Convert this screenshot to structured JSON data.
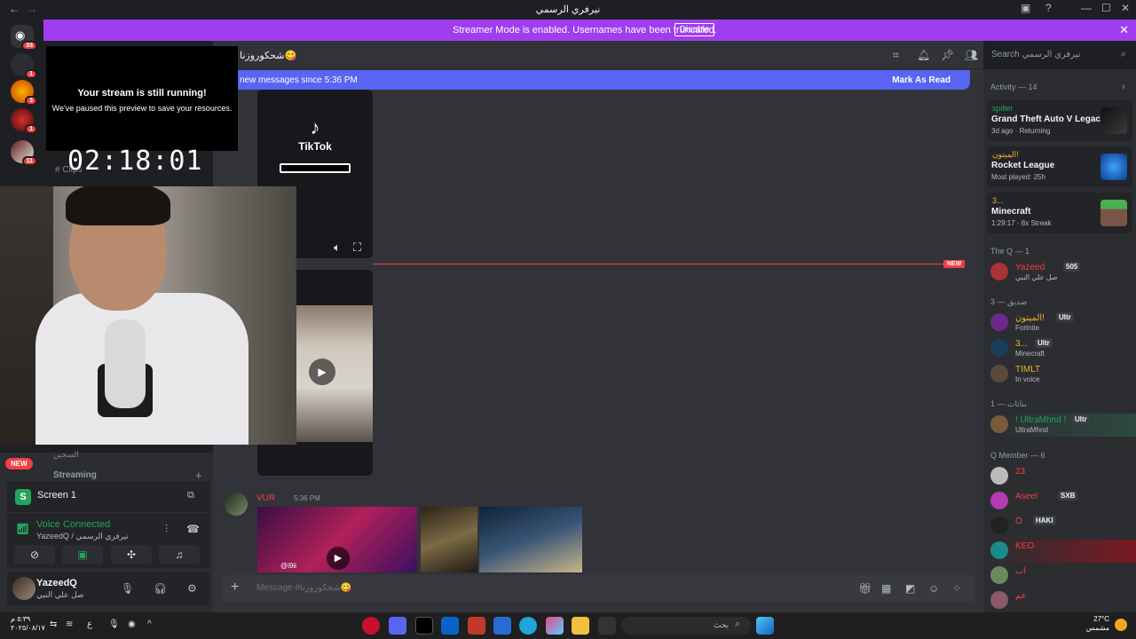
{
  "titlebar": {
    "title": "نيرفري الرسمي",
    "back": "←",
    "forward": "→"
  },
  "banner": {
    "message": "Streamer Mode is enabled. Usernames have been truncated.",
    "disable": "Disable",
    "close": "✕"
  },
  "guilds": {
    "home_badge": "33",
    "badges": [
      "1",
      "3",
      "1",
      "11"
    ]
  },
  "header": {
    "channel": "شحكوروزنا😋"
  },
  "search": {
    "placeholder": "Search نيرفري الرسمي"
  },
  "new_messages": {
    "text": "new messages since 5:36 PM",
    "mark": "Mark As Read"
  },
  "stream_overlay": {
    "title": "Your stream is still running!",
    "subtitle": "We've paused this preview to save your resources.",
    "timer": "02:18:01"
  },
  "channels": {
    "clips": "Clips",
    "lounge": "السجين",
    "new_badge": "NEW",
    "streaming": "Streaming"
  },
  "tiktok": {
    "label": "TikTok"
  },
  "new_tag": "NEW",
  "message2": {
    "author": "VUR",
    "time": "5:36 PM",
    "media_tag": "@i9ii"
  },
  "composer": {
    "placeholder": "Message #شحكوروزنا😋"
  },
  "screen_share": {
    "label": "Screen 1"
  },
  "voice": {
    "status": "Voice Connected",
    "sub": "YazeedQ / نيرفري الرسمي"
  },
  "user": {
    "name": "YazeedQ",
    "status": "صل علي النبي"
  },
  "members": {
    "activity_header": "Activity — 14",
    "activities": [
      {
        "name": "spiller",
        "game": "Grand Theft Auto V Legacy",
        "sub": "3d ago · Returning",
        "name_color": "#23a55a",
        "art": "GTA"
      },
      {
        "name": "الميتون!",
        "game": "Rocket League",
        "sub": "Most played: 25h",
        "name_color": "#f0b232",
        "art": "RL"
      },
      {
        "name": "3...",
        "game": "Minecraft",
        "sub": "1:29:17 · 8x Streak",
        "name_color": "#f0b232",
        "art": "MC"
      }
    ],
    "groups": [
      {
        "header": "The Q — 1",
        "members": [
          {
            "name": "Yazeed",
            "status": "صل علي النبي",
            "tag": "505",
            "color": "#f23f43"
          }
        ]
      },
      {
        "header": "صديق — 3",
        "members": [
          {
            "name": "الميتون!",
            "status": "Fortnite",
            "tag": "Ultr",
            "color": "#f0b232"
          },
          {
            "name": "3...",
            "status": "Minecraft",
            "tag": "Ultr",
            "color": "#f0b232"
          },
          {
            "name": "TIMLT",
            "status": "In voice",
            "tag": "",
            "color": "#f0b232"
          }
        ]
      },
      {
        "header": "بنانات — 1",
        "members": [
          {
            "name": "! UltraMhnd !",
            "status": "UltraMhnd",
            "tag": "Ultr",
            "color": "#23a55a"
          }
        ]
      },
      {
        "header": "Q Member — 6",
        "members": [
          {
            "name": "23",
            "status": "",
            "tag": "",
            "color": "#f23f43"
          },
          {
            "name": "Aseel",
            "status": "",
            "tag": "SXB",
            "color": "#f23f43"
          },
          {
            "name": "O",
            "status": "",
            "tag": "HAKI",
            "color": "#f23f43"
          },
          {
            "name": "KEO",
            "status": "",
            "tag": "",
            "color": "#f23f43"
          },
          {
            "name": "اب",
            "status": "",
            "tag": "",
            "color": "#f23f43"
          },
          {
            "name": "عم",
            "status": "",
            "tag": "",
            "color": "#f23f43"
          }
        ]
      }
    ]
  },
  "taskbar": {
    "time": "٥:٣٩ م",
    "date": "٢٠٢٥/٠٨/١٧",
    "search": "بحث",
    "temp": "27°C",
    "weather": "مشمس",
    "lang": "ع"
  },
  "colors": {
    "brand": "#5865f2",
    "streamer": "#a03df0",
    "online": "#23a55a",
    "danger": "#f23f43"
  }
}
